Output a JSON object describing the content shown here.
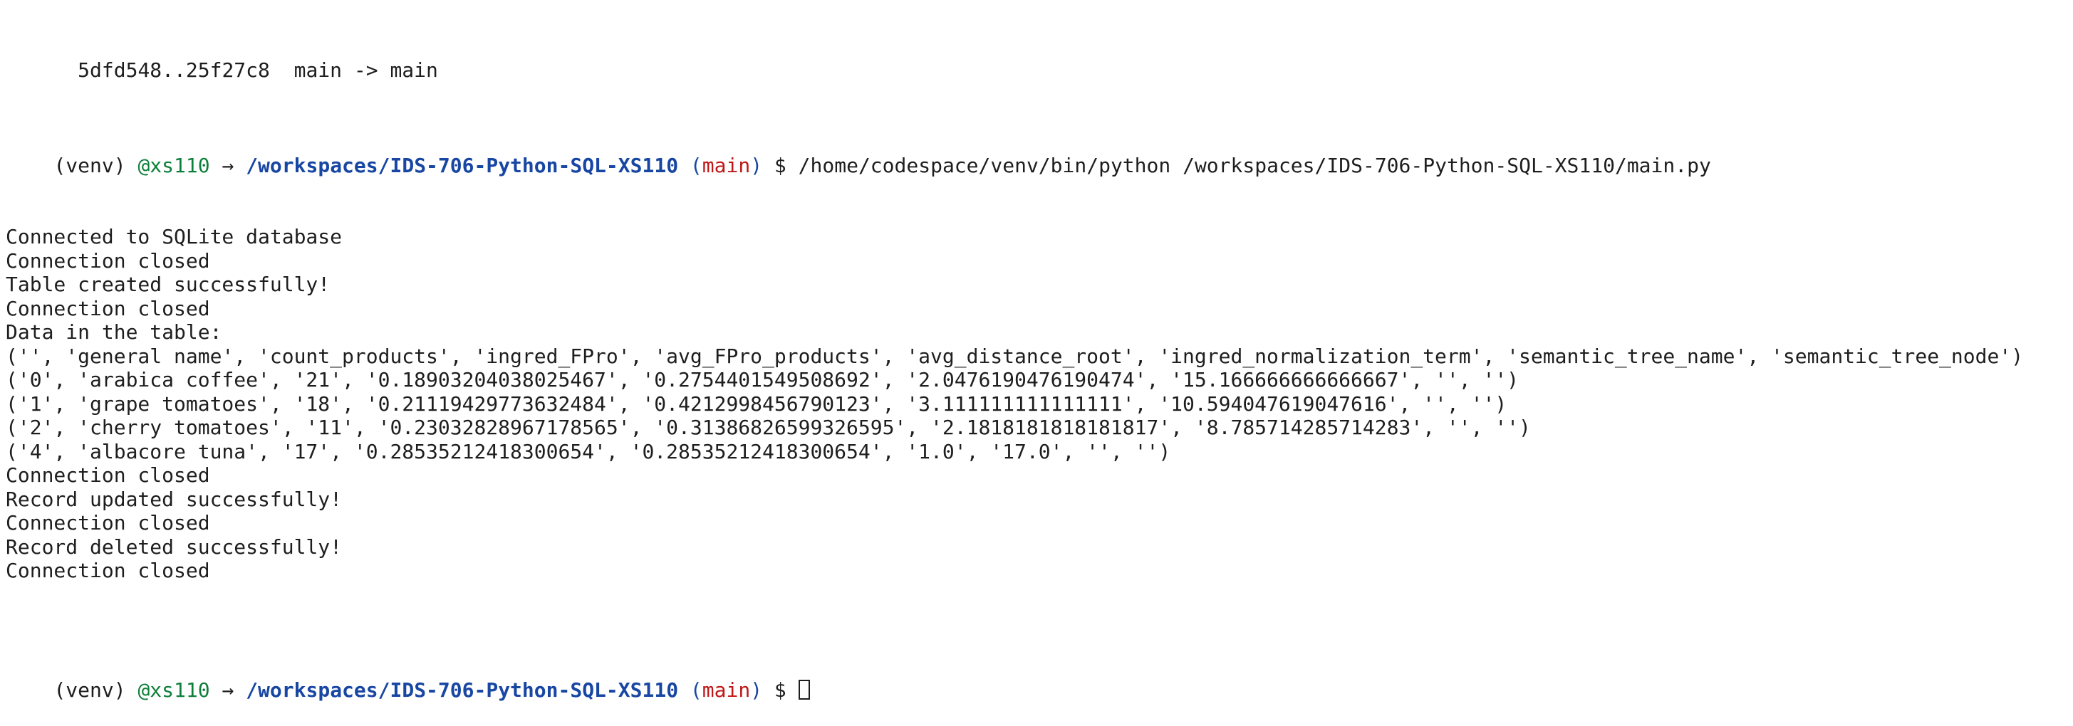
{
  "terminal": {
    "partial_top_line": "  5dfd548..25f27c8  main -> main",
    "prompt": {
      "venv": "(venv) ",
      "user": "@xs110",
      "arrow": " → ",
      "cwd": "/workspaces/IDS-706-Python-SQL-XS110",
      "branch_open": " (",
      "branch": "main",
      "branch_close": ")",
      "dollar": " $ ",
      "command": "/home/codespace/venv/bin/python /workspaces/IDS-706-Python-SQL-XS110/main.py"
    },
    "output_lines": [
      "Connected to SQLite database",
      "Connection closed",
      "Table created successfully!",
      "Connection closed",
      "Data in the table:",
      "('', 'general name', 'count_products', 'ingred_FPro', 'avg_FPro_products', 'avg_distance_root', 'ingred_normalization_term', 'semantic_tree_name', 'semantic_tree_node')",
      "('0', 'arabica coffee', '21', '0.18903204038025467', '0.2754401549508692', '2.0476190476190474', '15.166666666666667', '', '')",
      "('1', 'grape tomatoes', '18', '0.21119429773632484', '0.4212998456790123', '3.111111111111111', '10.594047619047616', '', '')",
      "('2', 'cherry tomatoes', '11', '0.23032828967178565', '0.31386826599326595', '2.1818181818181817', '8.785714285714283', '', '')",
      "('4', 'albacore tuna', '17', '0.28535212418300654', '0.28535212418300654', '1.0', '17.0', '', '')",
      "Connection closed",
      "Record updated successfully!",
      "Connection closed",
      "Record deleted successfully!",
      "Connection closed"
    ],
    "last_prompt": {
      "venv": "(venv) ",
      "user": "@xs110",
      "arrow": " → ",
      "cwd": "/workspaces/IDS-706-Python-SQL-XS110",
      "branch_open": " (",
      "branch": "main",
      "branch_close": ")",
      "dollar": " $ "
    }
  },
  "colors": {
    "background": "#ffffff",
    "text": "#1e1e1e",
    "user": "#0e7f3a",
    "path": "#1846a3",
    "branch": "#c01818"
  }
}
